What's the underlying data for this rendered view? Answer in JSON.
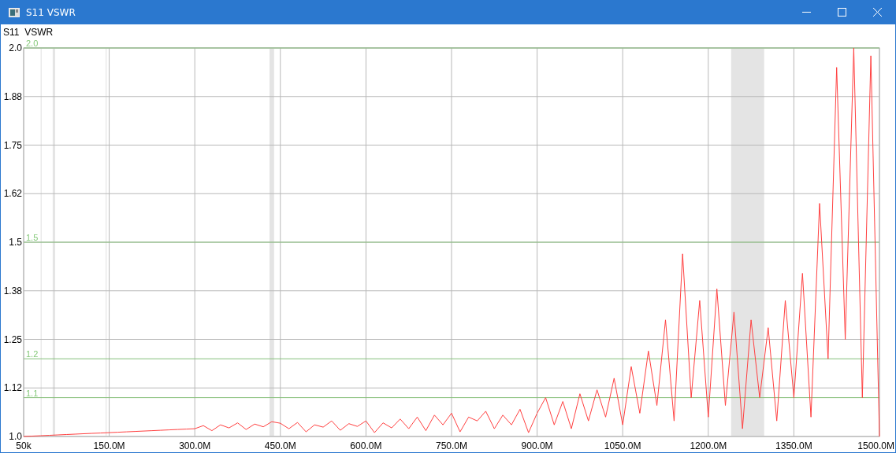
{
  "window": {
    "title": "S11 VSWR"
  },
  "plot": {
    "chart_data": {
      "type": "line",
      "title": "S11  VSWR",
      "x": [
        50000,
        15000000,
        30000000,
        45000000,
        60000000,
        75000000,
        90000000,
        105000000,
        120000000,
        135000000,
        150000000,
        165000000,
        180000000,
        195000000,
        210000000,
        225000000,
        240000000,
        255000000,
        270000000,
        285000000,
        300000000,
        315000000,
        330000000,
        345000000,
        360000000,
        375000000,
        390000000,
        405000000,
        420000000,
        435000000,
        450000000,
        465000000,
        480000000,
        495000000,
        510000000,
        525000000,
        540000000,
        555000000,
        570000000,
        585000000,
        600000000,
        615000000,
        630000000,
        645000000,
        660000000,
        675000000,
        690000000,
        705000000,
        720000000,
        735000000,
        750000000,
        765000000,
        780000000,
        795000000,
        810000000,
        825000000,
        840000000,
        855000000,
        870000000,
        885000000,
        900000000,
        915000000,
        930000000,
        945000000,
        960000000,
        975000000,
        990000000,
        1005000000,
        1020000000,
        1035000000,
        1050000000,
        1065000000,
        1080000000,
        1095000000,
        1110000000,
        1125000000,
        1140000000,
        1155000000,
        1170000000,
        1185000000,
        1200000000,
        1215000000,
        1230000000,
        1245000000,
        1260000000,
        1275000000,
        1290000000,
        1305000000,
        1320000000,
        1335000000,
        1350000000,
        1365000000,
        1380000000,
        1395000000,
        1410000000,
        1425000000,
        1440000000,
        1455000000,
        1470000000,
        1485000000,
        1500000000
      ],
      "series": [
        {
          "color": "#ff4040",
          "values": [
            1.0,
            1.001,
            1.002,
            1.003,
            1.004,
            1.005,
            1.006,
            1.007,
            1.008,
            1.009,
            1.01,
            1.011,
            1.012,
            1.013,
            1.014,
            1.015,
            1.016,
            1.017,
            1.018,
            1.019,
            1.02,
            1.028,
            1.015,
            1.03,
            1.022,
            1.035,
            1.018,
            1.032,
            1.025,
            1.038,
            1.034,
            1.02,
            1.036,
            1.012,
            1.03,
            1.024,
            1.04,
            1.016,
            1.033,
            1.026,
            1.04,
            1.01,
            1.035,
            1.022,
            1.045,
            1.02,
            1.05,
            1.015,
            1.055,
            1.03,
            1.06,
            1.012,
            1.05,
            1.04,
            1.065,
            1.02,
            1.055,
            1.03,
            1.07,
            1.01,
            1.06,
            1.1,
            1.03,
            1.09,
            1.02,
            1.11,
            1.04,
            1.12,
            1.05,
            1.15,
            1.03,
            1.18,
            1.06,
            1.22,
            1.08,
            1.3,
            1.04,
            1.47,
            1.1,
            1.35,
            1.05,
            1.38,
            1.08,
            1.32,
            1.02,
            1.3,
            1.1,
            1.28,
            1.04,
            1.35,
            1.1,
            1.42,
            1.05,
            1.6,
            1.2,
            1.95,
            1.25,
            2.0,
            1.1,
            1.98,
            1.0
          ]
        }
      ],
      "xlim": [
        50000,
        1500000000
      ],
      "ylim": [
        1.0,
        2.0
      ],
      "xticks": [
        {
          "value": 50000,
          "label": "50k"
        },
        {
          "value": 150000000,
          "label": "150.0M"
        },
        {
          "value": 300000000,
          "label": "300.0M"
        },
        {
          "value": 450000000,
          "label": "450.0M"
        },
        {
          "value": 600000000,
          "label": "600.0M"
        },
        {
          "value": 750000000,
          "label": "750.0M"
        },
        {
          "value": 900000000,
          "label": "900.0M"
        },
        {
          "value": 1050000000,
          "label": "1050.0M"
        },
        {
          "value": 1200000000,
          "label": "1200.0M"
        },
        {
          "value": 1350000000,
          "label": "1350.0M"
        },
        {
          "value": 1500000000,
          "label": "1500.0M"
        }
      ],
      "yticks": [
        {
          "value": 1.0,
          "label": "1.0"
        },
        {
          "value": 1.125,
          "label": "1.12"
        },
        {
          "value": 1.25,
          "label": "1.25"
        },
        {
          "value": 1.375,
          "label": "1.38"
        },
        {
          "value": 1.5,
          "label": "1.5"
        },
        {
          "value": 1.625,
          "label": "1.62"
        },
        {
          "value": 1.75,
          "label": "1.75"
        },
        {
          "value": 1.875,
          "label": "1.88"
        },
        {
          "value": 2.0,
          "label": "2.0"
        }
      ],
      "grid": true,
      "bands": [
        {
          "axis": "x",
          "from": 30000000,
          "to": 31400000,
          "color": "#e0e0e0"
        },
        {
          "axis": "x",
          "from": 51000000,
          "to": 55200000,
          "color": "#e4e4e4"
        },
        {
          "axis": "x",
          "from": 144000000,
          "to": 145400000,
          "color": "#e0e0e0"
        },
        {
          "axis": "x",
          "from": 431000000,
          "to": 439000000,
          "color": "#e4e4e4"
        },
        {
          "axis": "x",
          "from": 1240000000,
          "to": 1298000000,
          "color": "#e4e4e4"
        }
      ],
      "ref_lines": [
        {
          "axis": "y",
          "value": 2.0,
          "label": "2.0",
          "color": "#86bf7a"
        },
        {
          "axis": "y",
          "value": 1.5,
          "label": "1.5",
          "color": "#86bf7a"
        },
        {
          "axis": "y",
          "value": 1.2,
          "label": "1.2",
          "color": "#86bf7a"
        },
        {
          "axis": "y",
          "value": 1.1,
          "label": "1.1",
          "color": "#86bf7a"
        }
      ]
    }
  }
}
